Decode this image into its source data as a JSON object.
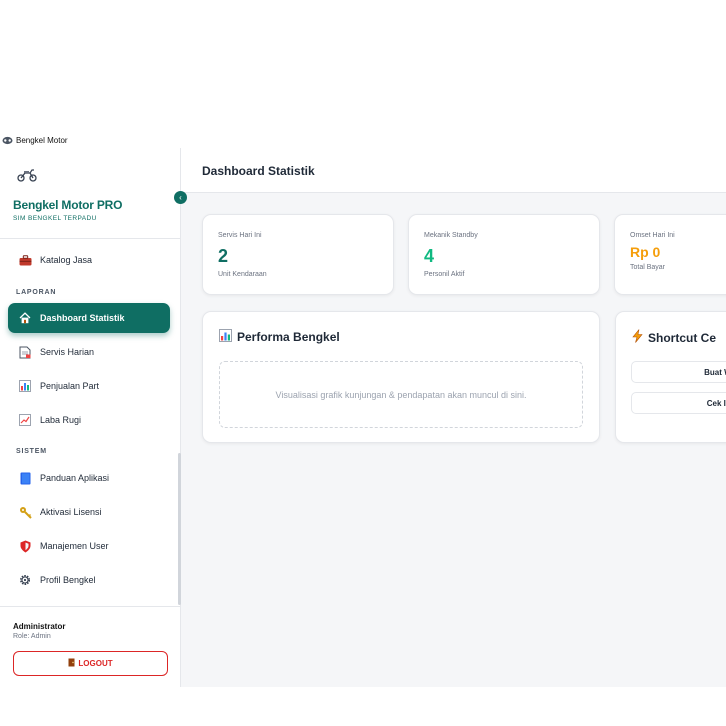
{
  "window": {
    "title": "Bengkel Motor"
  },
  "brand": {
    "title": "Bengkel Motor PRO",
    "subtitle": "SIM BENGKEL TERPADU",
    "collapse_glyph": "‹"
  },
  "sidebar": {
    "items": [
      {
        "label": "Katalog Jasa",
        "icon": "toolbox-icon"
      },
      {
        "label": "Dashboard Statistik",
        "icon": "house-icon",
        "active": true
      },
      {
        "label": "Servis Harian",
        "icon": "document-icon"
      },
      {
        "label": "Penjualan Part",
        "icon": "bar-chart-icon"
      },
      {
        "label": "Laba Rugi",
        "icon": "line-chart-icon"
      },
      {
        "label": "Panduan Aplikasi",
        "icon": "book-icon"
      },
      {
        "label": "Aktivasi Lisensi",
        "icon": "key-icon"
      },
      {
        "label": "Manajemen User",
        "icon": "shield-icon"
      },
      {
        "label": "Profil Bengkel",
        "icon": "gear-icon"
      }
    ],
    "sections": {
      "laporan": "LAPORAN",
      "sistem": "SISTEM"
    }
  },
  "user": {
    "name": "Administrator",
    "role": "Role: Admin",
    "logout_label": "LOGOUT"
  },
  "header": {
    "title": "Dashboard Statistik"
  },
  "stats": [
    {
      "label": "Servis Hari Ini",
      "value": "2",
      "sub": "Unit Kendaraan",
      "color": "#0f6e63"
    },
    {
      "label": "Mekanik Standby",
      "value": "4",
      "sub": "Personil Aktif",
      "color": "#10b981"
    },
    {
      "label": "Omset Hari Ini",
      "value": "Rp 0",
      "sub": "Total Bayar",
      "color": "#f59e0b"
    }
  ],
  "performance": {
    "title": "Performa Bengkel",
    "placeholder": "Visualisasi grafik kunjungan & pendapatan akan muncul di sini."
  },
  "shortcut": {
    "title": "Shortcut Ce",
    "buttons": [
      "Buat WO",
      "Cek Inv"
    ]
  }
}
